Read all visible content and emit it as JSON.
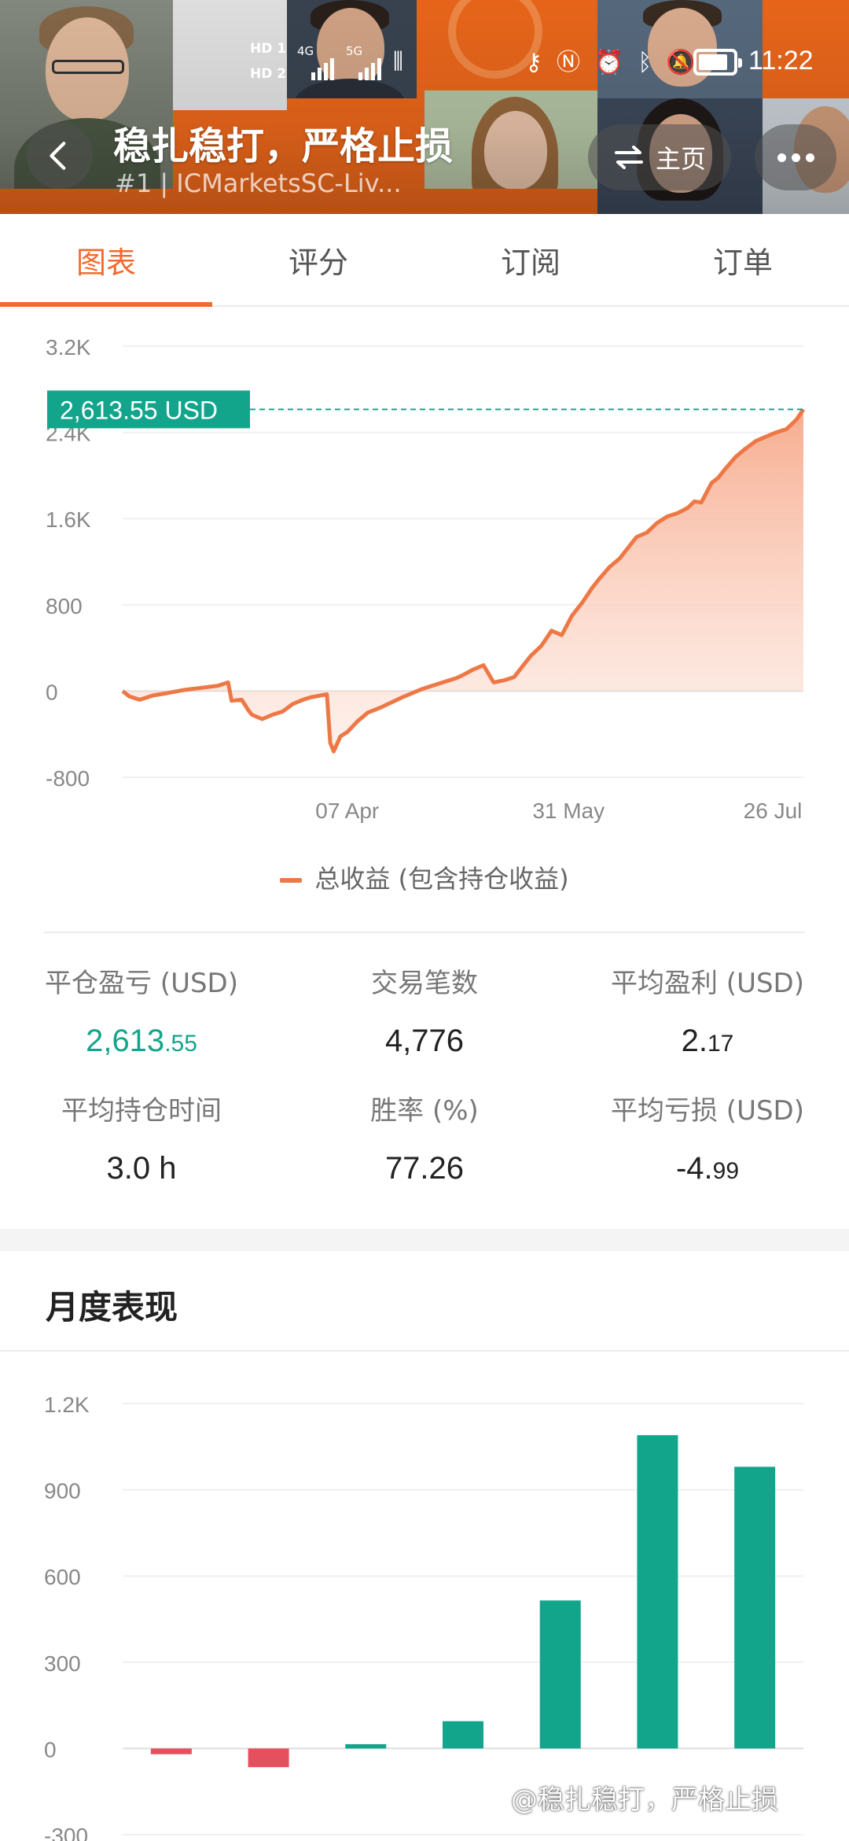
{
  "status_bar": {
    "time": "11:22",
    "sim1": "HD 1",
    "sim2": "HD 2",
    "net1": "4G",
    "net2": "5G",
    "battery_level": 0.85,
    "icons": [
      "key-icon",
      "nfc-icon",
      "alarm-icon",
      "bluetooth-icon",
      "mute-icon"
    ]
  },
  "header": {
    "title": "稳扎稳打，严格止损",
    "subtitle": "#1 | ICMarketsSC-Liv...",
    "home_label": "主页"
  },
  "tabs": [
    {
      "label": "图表",
      "active": true
    },
    {
      "label": "评分",
      "active": false
    },
    {
      "label": "订阅",
      "active": false
    },
    {
      "label": "订单",
      "active": false
    }
  ],
  "profit_chart": {
    "current_label": "2,613.55 USD",
    "legend": "总收益 (包含持仓收益)"
  },
  "stats": [
    {
      "label": "平仓盈亏 (USD)",
      "int": "2,613",
      "dec": ".55",
      "green": true
    },
    {
      "label": "交易笔数",
      "int": "4,776",
      "dec": "",
      "green": false
    },
    {
      "label": "平均盈利 (USD)",
      "int": "2.",
      "dec": "17",
      "green": false
    },
    {
      "label": "平均持仓时间",
      "int": "3.0 h",
      "dec": "",
      "green": false
    },
    {
      "label": "胜率 (%)",
      "int": "77.26",
      "dec": "",
      "green": false
    },
    {
      "label": "平均亏损 (USD)",
      "int": "-4.",
      "dec": "99",
      "green": false
    }
  ],
  "monthly": {
    "title": "月度表现"
  },
  "watermark": "@稳扎稳打，严格止损",
  "colors": {
    "accent_orange": "#f26a2e",
    "line_orange": "#ee7845",
    "teal": "#13a58c",
    "red": "#e5505f"
  },
  "chart_data": [
    {
      "type": "area",
      "ylim": [
        -800,
        3200
      ],
      "yticks": [
        -800,
        0,
        800,
        1600,
        2400,
        3200
      ],
      "ytick_labels": [
        "-800",
        "0",
        "800",
        "1.6K",
        "2.4K",
        "3.2K"
      ],
      "xtick_labels": [
        "07 Apr",
        "31 May",
        "26 Jul"
      ],
      "xtick_positions": [
        0.33,
        0.655,
        0.955
      ],
      "current_value": 2613.55,
      "series": [
        {
          "name": "总收益 (包含持仓收益)",
          "x": [
            0.0,
            0.01,
            0.025,
            0.045,
            0.065,
            0.09,
            0.115,
            0.14,
            0.155,
            0.16,
            0.175,
            0.185,
            0.19,
            0.205,
            0.22,
            0.235,
            0.25,
            0.265,
            0.275,
            0.3,
            0.305,
            0.31,
            0.32,
            0.33,
            0.345,
            0.36,
            0.38,
            0.41,
            0.44,
            0.47,
            0.49,
            0.5,
            0.515,
            0.53,
            0.545,
            0.56,
            0.575,
            0.59,
            0.6,
            0.615,
            0.63,
            0.645,
            0.66,
            0.675,
            0.69,
            0.7,
            0.715,
            0.73,
            0.745,
            0.755,
            0.77,
            0.785,
            0.8,
            0.815,
            0.83,
            0.84,
            0.85,
            0.865,
            0.875,
            0.885,
            0.9,
            0.915,
            0.93,
            0.945,
            0.96,
            0.975,
            0.99,
            1.0
          ],
          "y": [
            0,
            -50,
            -80,
            -40,
            -20,
            10,
            30,
            50,
            80,
            -90,
            -80,
            -180,
            -220,
            -260,
            -220,
            -190,
            -120,
            -80,
            -60,
            -30,
            -480,
            -560,
            -420,
            -380,
            -280,
            -200,
            -150,
            -60,
            20,
            80,
            120,
            150,
            200,
            240,
            80,
            100,
            130,
            250,
            330,
            420,
            560,
            520,
            700,
            820,
            960,
            1040,
            1150,
            1230,
            1350,
            1430,
            1470,
            1560,
            1620,
            1650,
            1700,
            1760,
            1750,
            1930,
            1980,
            2060,
            2170,
            2250,
            2320,
            2360,
            2400,
            2430,
            2520,
            2613.55
          ]
        }
      ]
    },
    {
      "type": "bar",
      "title": "月度表现",
      "ylim": [
        -300,
        1200
      ],
      "yticks": [
        -300,
        0,
        300,
        600,
        900,
        1200
      ],
      "ytick_labels": [
        "-300",
        "0",
        "300",
        "600",
        "900",
        "1.2K"
      ],
      "values": [
        -20,
        -65,
        15,
        95,
        515,
        1090,
        980
      ]
    }
  ]
}
